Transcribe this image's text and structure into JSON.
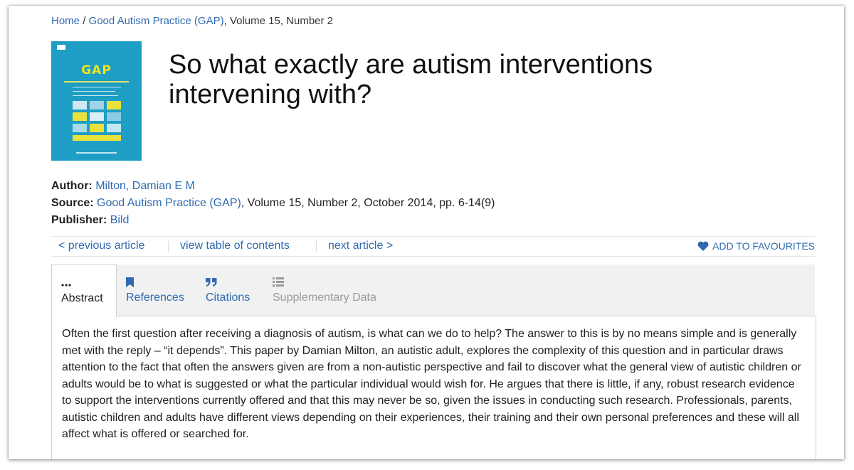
{
  "breadcrumb": {
    "home": "Home",
    "sep": "/",
    "journal": "Good Autism Practice (GAP)",
    "rest": ", Volume 15, Number 2"
  },
  "cover": {
    "title": "GAP"
  },
  "article": {
    "title_line1": "So what exactly are autism interventions",
    "title_line2": "intervening with?"
  },
  "meta": {
    "author_label": "Author:",
    "author": "Milton, Damian E M",
    "source_label": "Source:",
    "source_journal": "Good Autism Practice (GAP)",
    "source_rest": ", Volume 15, Number 2, October 2014, pp. 6-14(9)",
    "publisher_label": "Publisher:",
    "publisher": "Bild"
  },
  "nav": {
    "previous": "< previous article",
    "toc": "view table of contents",
    "next": "next article >",
    "favourites": "ADD TO FAVOURITES"
  },
  "tabs": [
    {
      "label": "Abstract",
      "icon": "ellipsis-icon"
    },
    {
      "label": "References",
      "icon": "bookmark-icon"
    },
    {
      "label": "Citations",
      "icon": "quote-icon"
    },
    {
      "label": "Supplementary Data",
      "icon": "list-icon"
    }
  ],
  "abstract": {
    "text": "Often the first question after receiving a diagnosis of autism, is what can we do to help? The answer to this is by no means simple and is generally met with the reply – “it depends”. This paper by Damian Milton, an autistic adult, explores the complexity of this question and in particular draws attention to the fact that often the answers given are from a non-autistic perspective and fail to discover what the general view of autistic children or adults would be to what is suggested or what the particular individual would wish for. He argues that there is little, if any, robust research evidence to support the interventions currently offered and that this may never be so, given the issues in conducting such research. Professionals, parents, autistic children and adults have different views depending on their experiences, their training and their own personal preferences and these will all affect what is offered or searched for."
  },
  "colors": {
    "link": "#2f6ab0",
    "cover_bg": "#1e9ec4",
    "cover_title": "#f4e41b",
    "tab_bar": "#f1f1f1"
  }
}
